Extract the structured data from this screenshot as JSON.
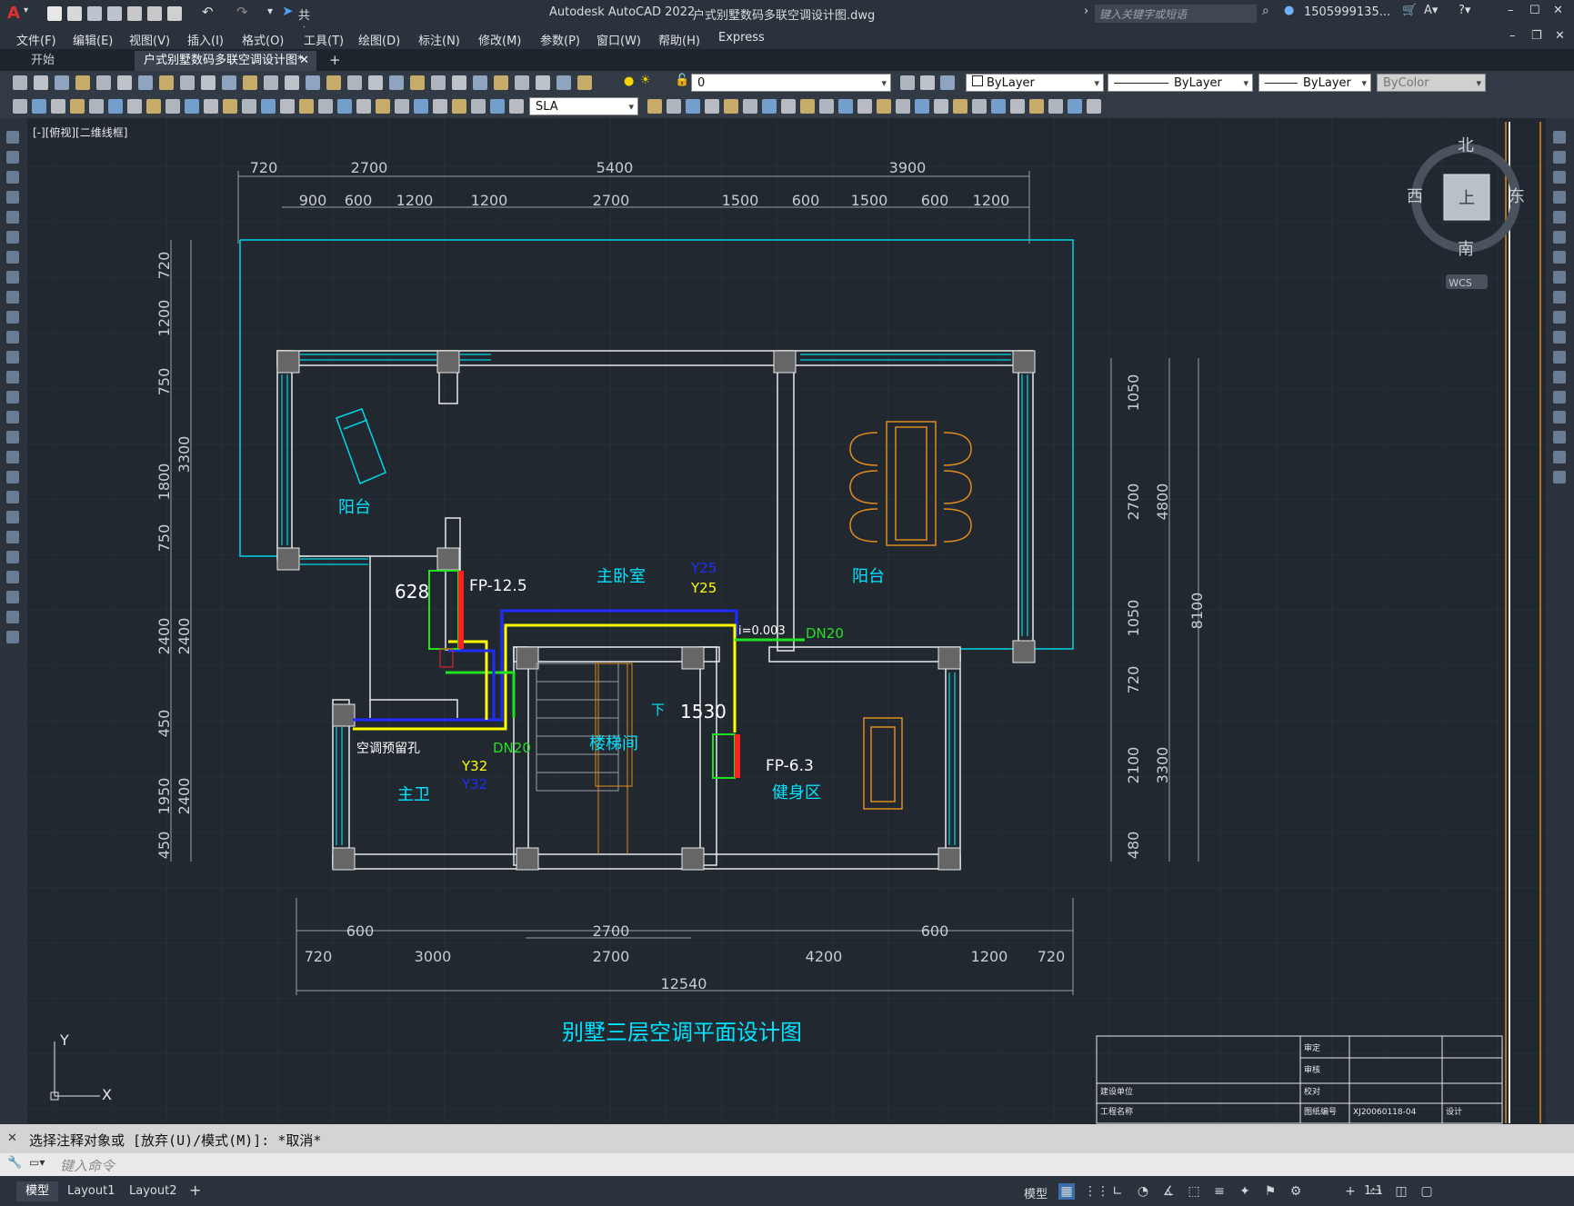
{
  "app": {
    "logo": "A",
    "title": "Autodesk AutoCAD 2022",
    "file": "户式别墅数码多联空调设计图.dwg",
    "share_label": "共享",
    "search_placeholder": "键入关键字或短语",
    "user": "1505999135...",
    "window_controls": [
      "minimize-icon",
      "maximize-icon",
      "close-icon"
    ]
  },
  "menu": [
    "文件(F)",
    "编辑(E)",
    "视图(V)",
    "插入(I)",
    "格式(O)",
    "工具(T)",
    "绘图(D)",
    "标注(N)",
    "修改(M)",
    "参数(P)",
    "窗口(W)",
    "帮助(H)",
    "Express"
  ],
  "doc_tabs": {
    "start": "开始",
    "active": "户式别墅数码多联空调设计图*",
    "close": "✕",
    "add": "+"
  },
  "toolbar": {
    "layer_value": "0",
    "color_value": "ByLayer",
    "linetype_value": "ByLayer",
    "lineweight_value": "ByLayer",
    "plotstyle_value": "ByColor",
    "textstyle_value": "SLA"
  },
  "viewport_label": "[-][俯视][二维线框]",
  "viewcube": {
    "north": "北",
    "south": "南",
    "east": "东",
    "west": "西",
    "top": "上",
    "wcs": "WCS"
  },
  "drawing": {
    "title": "别墅三层空调平面设计图",
    "dims_top_row1": [
      "720",
      "2700",
      "5400",
      "3900"
    ],
    "dims_top_row2": [
      "900",
      "600",
      "1200",
      "1200",
      "2700",
      "1500",
      "600",
      "1500",
      "600",
      "1200"
    ],
    "dims_left": [
      "720",
      "1200",
      "750",
      "1800",
      "750",
      "3300",
      "2400",
      "2400",
      "450",
      "1950",
      "450",
      "2400"
    ],
    "dims_right": [
      "1050",
      "2700",
      "4800",
      "1050",
      "720",
      "8100",
      "2100",
      "3300",
      "480"
    ],
    "dims_bottom_row1": [
      "600",
      "2700",
      "600"
    ],
    "dims_bottom_row2": [
      "720",
      "3000",
      "2700",
      "4200",
      "1200",
      "720"
    ],
    "dims_bottom_total": "12540",
    "rooms": [
      "阳台",
      "主卧室",
      "阳台",
      "主卫",
      "楼梯间",
      "健身区"
    ],
    "labels": {
      "fp_left": "FP-12.5",
      "fp_right": "FP-6.3",
      "num_628": "628",
      "num_1530": "1530",
      "down": "下",
      "slope": "i=0.003",
      "dn20_a": "DN20",
      "dn20_b": "DN20",
      "y25_a": "Y25",
      "y25_b": "Y25",
      "y32_a": "Y32",
      "y32_b": "Y32",
      "ac_hole": "空调预留孔"
    },
    "title_block": [
      "审定",
      "审核",
      "校对",
      "建设单位",
      "图纸编号",
      "工程名称",
      "设计",
      "XJ20060118-04"
    ]
  },
  "ucs": {
    "x": "X",
    "y": "Y"
  },
  "command": {
    "history": "选择注释对象或 [放弃(U)/模式(M)]: *取消*",
    "placeholder": "键入命令"
  },
  "status": {
    "tabs": [
      "模型",
      "Layout1",
      "Layout2"
    ],
    "add": "+",
    "model_label": "模型",
    "scale": "1:1"
  },
  "colors": {
    "cyan": "#00e5ff",
    "blue": "#1f2cff",
    "yellow": "#ffff00",
    "green": "#22e022",
    "red": "#ff2020",
    "orange": "#e08a20",
    "wall": "#e8e8e8"
  }
}
